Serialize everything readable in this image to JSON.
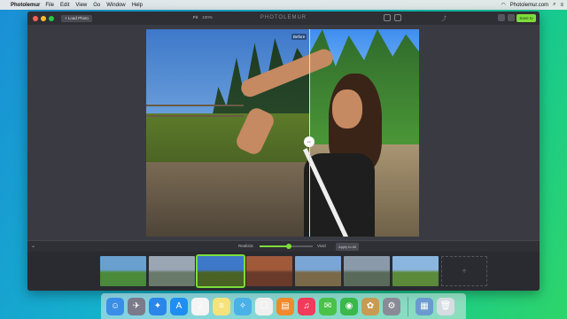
{
  "menubar": {
    "app_name": "Photolemur",
    "items": [
      "File",
      "Edit",
      "View",
      "Go",
      "Window",
      "Help"
    ],
    "right_text": "Photolemur.com",
    "search_icon": "search-icon",
    "list_icon": "list-icon"
  },
  "window": {
    "title": "PHOTOLEMUR",
    "load_button": "+ Load Photo",
    "zoom_fit": "Fit",
    "zoom_percent": "100%",
    "save_button": "Save to",
    "before_label": "Before"
  },
  "bottombar": {
    "strength_label": "Realistic",
    "max_label": "Vivid",
    "strength_value": 0.55,
    "apply_button": "Apply to All"
  },
  "filmstrip": {
    "thumbs": [
      {
        "name": "thumb-field",
        "colors": [
          "#6aa0d0",
          "#4a8a3a"
        ]
      },
      {
        "name": "thumb-hills",
        "colors": [
          "#9aa6b4",
          "#6a7a6a"
        ]
      },
      {
        "name": "thumb-portrait",
        "colors": [
          "#3d78c9",
          "#4a6224"
        ],
        "selected": true
      },
      {
        "name": "thumb-autumn",
        "colors": [
          "#a05a3a",
          "#6a3a2a"
        ]
      },
      {
        "name": "thumb-road",
        "colors": [
          "#7aa6d6",
          "#7a6a4a"
        ]
      },
      {
        "name": "thumb-mountain",
        "colors": [
          "#8a9aaa",
          "#5a6a5a"
        ]
      },
      {
        "name": "thumb-trees",
        "colors": [
          "#8ab6e0",
          "#5a8a3a"
        ]
      }
    ],
    "empty_slot": "+"
  },
  "accent": "#7ddc3a",
  "dock": {
    "icons": [
      {
        "name": "finder-icon",
        "color": "#3a8ee8",
        "glyph": "☺"
      },
      {
        "name": "launchpad-icon",
        "color": "#7a7a8a",
        "glyph": "✈"
      },
      {
        "name": "safari-icon",
        "color": "#2a86e8",
        "glyph": "✦"
      },
      {
        "name": "appstore-icon",
        "color": "#1f8ef0",
        "glyph": "A"
      },
      {
        "name": "calendar-icon",
        "color": "#f4f4f4",
        "glyph": "2"
      },
      {
        "name": "notes-icon",
        "color": "#f6e27a",
        "glyph": "≡"
      },
      {
        "name": "maps-icon",
        "color": "#4ab0e8",
        "glyph": "✧"
      },
      {
        "name": "reminders-icon",
        "color": "#f0f0f0",
        "glyph": "☐"
      },
      {
        "name": "ibooks-icon",
        "color": "#f08a2a",
        "glyph": "▤"
      },
      {
        "name": "music-icon",
        "color": "#f23a5a",
        "glyph": "♫"
      },
      {
        "name": "messages-icon",
        "color": "#4ac24a",
        "glyph": "✉"
      },
      {
        "name": "facetime-icon",
        "color": "#3ab84a",
        "glyph": "◉"
      },
      {
        "name": "photos-icon",
        "color": "#c89a52",
        "glyph": "✿"
      },
      {
        "name": "preferences-icon",
        "color": "#8a8a96",
        "glyph": "⚙"
      }
    ],
    "right_icons": [
      {
        "name": "downloads-folder-icon",
        "color": "#6a9ad0",
        "glyph": "▦"
      },
      {
        "name": "trash-icon",
        "color": "#d6dde2",
        "glyph": "🗑"
      }
    ]
  }
}
